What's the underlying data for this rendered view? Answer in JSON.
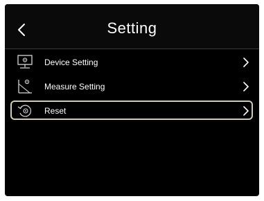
{
  "header": {
    "title": "Setting"
  },
  "menu": {
    "items": [
      {
        "label": "Device Setting",
        "icon": "monitor-gear-icon",
        "selected": false
      },
      {
        "label": "Measure Setting",
        "icon": "measure-icon",
        "selected": false
      },
      {
        "label": "Reset",
        "icon": "reset-icon",
        "selected": true
      }
    ]
  },
  "colors": {
    "background": "#000000",
    "text": "#ffffff",
    "selection_border": "#cfcfae"
  }
}
